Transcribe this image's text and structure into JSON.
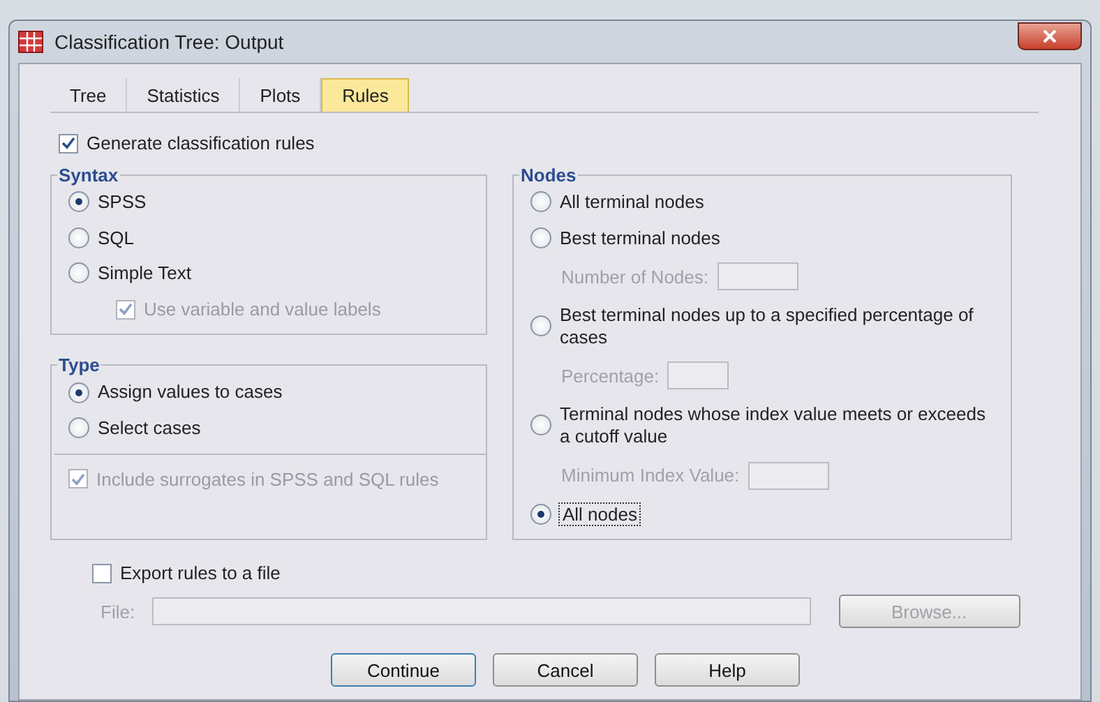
{
  "window": {
    "title": "Classification Tree: Output"
  },
  "tabs": [
    {
      "label": "Tree",
      "selected": false
    },
    {
      "label": "Statistics",
      "selected": false
    },
    {
      "label": "Plots",
      "selected": false
    },
    {
      "label": "Rules",
      "selected": true
    }
  ],
  "generate_rules": {
    "label": "Generate classification rules",
    "checked": true
  },
  "syntax": {
    "title": "Syntax",
    "items": [
      {
        "kind": "radio",
        "label": "SPSS",
        "selected": true,
        "focused": false
      },
      {
        "kind": "radio",
        "label": "SQL",
        "selected": false,
        "focused": false
      },
      {
        "kind": "radio",
        "label": "Simple Text",
        "selected": false,
        "focused": false
      },
      {
        "kind": "checkbox",
        "label": "Use variable and value labels",
        "checked": true,
        "disabled": true
      }
    ]
  },
  "type": {
    "title": "Type",
    "items": [
      {
        "kind": "radio",
        "label": "Assign values to cases",
        "selected": true,
        "focused": false
      },
      {
        "kind": "radio",
        "label": "Select cases",
        "selected": false,
        "focused": false
      },
      {
        "kind": "divider"
      },
      {
        "kind": "checkbox",
        "label": "Include surrogates in SPSS and SQL rules",
        "checked": true,
        "disabled": true
      }
    ]
  },
  "nodes": {
    "title": "Nodes",
    "items": [
      {
        "kind": "radio",
        "label": "All terminal nodes",
        "selected": false,
        "focused": false
      },
      {
        "kind": "radio",
        "label": "Best terminal nodes",
        "selected": false,
        "focused": false
      },
      {
        "kind": "field",
        "label": "Number of Nodes:",
        "disabled": true
      },
      {
        "kind": "radio",
        "label": "Best terminal nodes up to a specified percentage of cases",
        "selected": false,
        "focused": false
      },
      {
        "kind": "field",
        "label": "Percentage:",
        "disabled": true
      },
      {
        "kind": "radio",
        "label": "Terminal nodes whose index value meets or exceeds a cutoff value",
        "selected": false,
        "focused": false
      },
      {
        "kind": "field",
        "label": "Minimum Index Value:",
        "disabled": true
      },
      {
        "kind": "radio",
        "label": "All nodes",
        "selected": true,
        "focused": true
      }
    ]
  },
  "export": {
    "label": "Export rules to a file",
    "checked": false,
    "file_label": "File:",
    "browse": "Browse...",
    "disabled": true
  },
  "buttons": [
    {
      "label": "Continue",
      "default": true
    },
    {
      "label": "Cancel",
      "default": false
    },
    {
      "label": "Help",
      "default": false
    }
  ]
}
